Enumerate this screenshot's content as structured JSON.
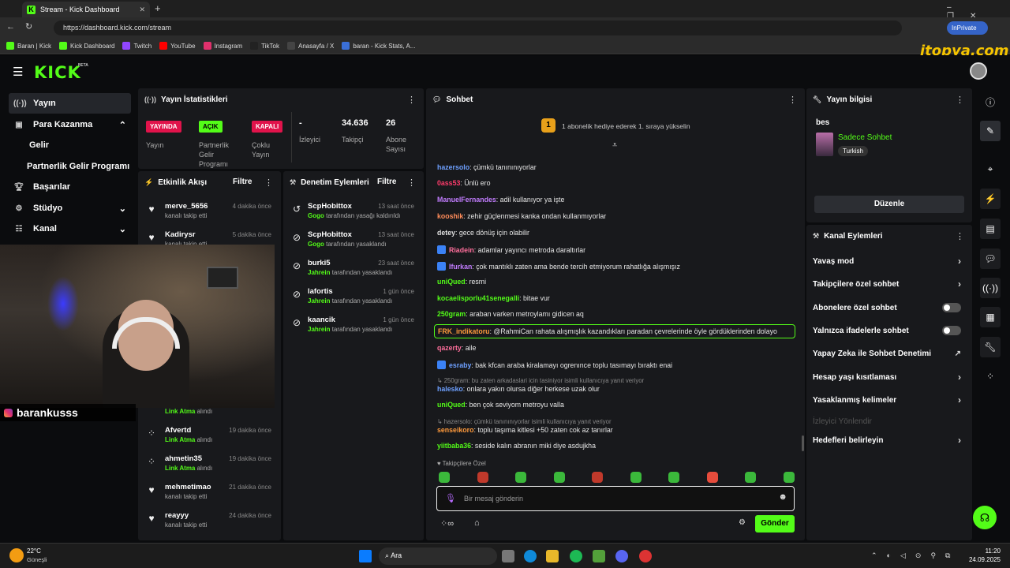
{
  "browser": {
    "tab_title": "Stream - Kick Dashboard",
    "url": "https://dashboard.kick.com/stream",
    "inprivate": "InPrivate",
    "bookmarks": [
      {
        "label": "Baran | Kick",
        "color": "#53fc18"
      },
      {
        "label": "Kick Dashboard",
        "color": "#53fc18"
      },
      {
        "label": "Twitch",
        "color": "#9146ff"
      },
      {
        "label": "YouTube",
        "color": "#ff0000"
      },
      {
        "label": "Instagram",
        "color": "#e1306c"
      },
      {
        "label": "TikTok",
        "color": "#222222"
      },
      {
        "label": "Anasayfa / X",
        "color": "#444444"
      },
      {
        "label": "baran - Kick Stats, A...",
        "color": "#3a6fd8"
      }
    ]
  },
  "watermark": "itopya.com",
  "app": {
    "logo": "KICK",
    "logo_beta": "BETA",
    "sidebar": {
      "items": [
        {
          "label": "Yayın",
          "icon": "broadcast-icon"
        },
        {
          "label": "Para Kazanma",
          "icon": "money-icon"
        },
        {
          "label": "Gelir"
        },
        {
          "label": "Partnerlik Gelir Programı"
        },
        {
          "label": "Başarılar",
          "icon": "trophy-icon"
        },
        {
          "label": "Stüdyo",
          "icon": "studio-icon"
        },
        {
          "label": "Kanal",
          "icon": "channel-icon"
        }
      ]
    },
    "stats": {
      "title": "Yayın İstatistikleri",
      "badges": [
        {
          "value": "YAYINDA",
          "label": "Yayın",
          "color": "#e1134b"
        },
        {
          "value": "AÇIK",
          "label": "Partnerlik Gelir Programı",
          "color": "#53fc18"
        },
        {
          "value": "KAPALI",
          "label": "Çoklu Yayın",
          "color": "#e1134b"
        }
      ],
      "numbers": [
        {
          "value": "-",
          "label": "İzleyici"
        },
        {
          "value": "34.636",
          "label": "Takipçi"
        },
        {
          "value": "26",
          "label": "Abone Sayısı"
        }
      ]
    },
    "activity": {
      "title": "Etkinlik Akışı",
      "filter": "Filtre",
      "items_top": [
        {
          "name": "merve_5656",
          "sub": "kanalı takip etti",
          "time": "4 dakika önce"
        },
        {
          "name": "Kadirysr",
          "sub": "kanalı takip etti",
          "time": "5 dakika önce"
        }
      ],
      "partial_sub_prefix": "Link Atma",
      "partial_sub_suffix": "alındı",
      "items_bottom": [
        {
          "name": "Afvertd",
          "sub_green": "Link Atma",
          "sub": "alındı",
          "time": "19 dakika önce",
          "icon": "gift-icon"
        },
        {
          "name": "ahmetin35",
          "sub_green": "Link Atma",
          "sub": "alındı",
          "time": "19 dakika önce",
          "icon": "gift-icon"
        },
        {
          "name": "mehmetimao",
          "sub_green": "",
          "sub": "kanalı takip etti",
          "time": "21 dakika önce",
          "icon": "heart-icon"
        },
        {
          "name": "reayyy",
          "sub_green": "",
          "sub": "kanalı takip etti",
          "time": "24 dakika önce",
          "icon": "heart-icon"
        }
      ]
    },
    "moderation": {
      "title": "Denetim Eylemleri",
      "filter": "Filtre",
      "items": [
        {
          "name": "ScpHobittox",
          "by": "Gogo",
          "action": "tarafından yasağı kaldırıldı",
          "time": "13 saat önce",
          "icon": "undo-icon"
        },
        {
          "name": "ScpHobittox",
          "by": "Gogo",
          "action": "tarafından yasaklandı",
          "time": "13 saat önce",
          "icon": "ban-icon"
        },
        {
          "name": "burki5",
          "by": "Jahrein",
          "action": "tarafından yasaklandı",
          "time": "23 saat önce",
          "icon": "ban-icon"
        },
        {
          "name": "lafortis",
          "by": "Jahrein",
          "action": "tarafından yasaklandı",
          "time": "1 gün önce",
          "icon": "ban-icon"
        },
        {
          "name": "kaancik",
          "by": "Jahrein",
          "action": "tarafından yasaklandı",
          "time": "1 gün önce",
          "icon": "ban-icon"
        }
      ]
    },
    "chat": {
      "title": "Sohbet",
      "sub_banner": "1 abonelik hediye ederek 1. sıraya yükselin",
      "sub_rank": "1",
      "messages": [
        {
          "user": "hazersolo",
          "color": "#6ea0ff",
          "text": ": çümkü tanınınıyorlar"
        },
        {
          "user": "0ass53",
          "color": "#ff3b6b",
          "text": ": Ünlü ero"
        },
        {
          "user": "ManuelFernandes",
          "color": "#c27dff",
          "text": ": adil kullanıyor ya işte"
        },
        {
          "user": "kooshik",
          "color": "#ff8c5a",
          "text": ": zehir güçlenmesi kanka ondan kullanmıyorlar"
        },
        {
          "user": "detey",
          "color": "#e0e0e0",
          "text": ": gece dönüş için olabilir"
        },
        {
          "user": "Riadein",
          "color": "#ff6f9c",
          "text": ": adamlar yayıncı metroda daraltırlar"
        },
        {
          "user": "Ifurkan",
          "color": "#c27dff",
          "text": ": çok mantıklı zaten ama bende tercih etmiyorum rahatlığa alışmışız"
        },
        {
          "user": "uniQued",
          "color": "#53fc18",
          "text": ": resmi"
        },
        {
          "user": "kocaelisporlu41senegalli",
          "color": "#53fc18",
          "text": ": bitae vur"
        },
        {
          "user": "250gram",
          "color": "#53fc18",
          "text": ": araban varken metroylamı gidicen aq"
        },
        {
          "user": "FRK_indikatoru",
          "color": "#ff9a3c",
          "text": ": @RahmiCan rahata alışmışlık kazandıkları paradan çevrelerinde öyle gördüklerinden dolayo"
        },
        {
          "user": "qazerty",
          "color": "#ff6f9c",
          "text": ": aile"
        },
        {
          "user": "esraby",
          "color": "#6ea0ff",
          "text": ": bak kfcan araba kiralamayı ogrenınce toplu tasımayı bıraktı enai"
        },
        {
          "user": "halesko",
          "color": "#6ea0ff",
          "text": ": onlara yakın olursa diğer herkese uzak olur"
        },
        {
          "user": "uniQued",
          "color": "#53fc18",
          "text": ": ben çok seviyom metroyu valla"
        },
        {
          "user": "senseikoro",
          "color": "#ff9a3c",
          "text": ": toplu taşıma kitlesi +50 zaten cok az tanırlar"
        },
        {
          "user": "yiitbaba36",
          "color": "#53fc18",
          "text": ": seside kalın abranın miki diye asdujkha"
        }
      ],
      "replies": [
        "250gram: bu zaten arkadaslari icin tasiniyor isimli kullanıcıya yanıt veriyor",
        "hazersolo: çümkü tanınınıyorlar isimli kullanıcıya yanıt veriyor"
      ],
      "followers_only": "Takipçilere Özel",
      "input_placeholder": "Bir mesaj gönderin",
      "send": "Gönder"
    },
    "stream_info": {
      "title": "Yayın bilgisi",
      "stream_title": "bes",
      "category": "Sadece Sohbet",
      "language": "Turkish",
      "edit": "Düzenle"
    },
    "channel_actions": {
      "title": "Kanal Eylemleri",
      "items": [
        {
          "label": "Yavaş mod",
          "control": "chevron"
        },
        {
          "label": "Takipçilere özel sohbet",
          "control": "chevron"
        },
        {
          "label": "Abonelere özel sohbet",
          "control": "toggle"
        },
        {
          "label": "Yalnızca ifadelerle sohbet",
          "control": "toggle"
        },
        {
          "label": "Yapay Zeka ile Sohbet Denetimi",
          "control": "external"
        },
        {
          "label": "Hesap yaşı kısıtlaması",
          "control": "chevron"
        },
        {
          "label": "Yasaklanmış kelimeler",
          "control": "chevron"
        },
        {
          "label": "İzleyici Yönlendir",
          "control": "disabled"
        },
        {
          "label": "Hedefleri belirleyin",
          "control": "chevron"
        }
      ]
    },
    "webcam_name": "barankusss"
  },
  "taskbar": {
    "weather_temp": "22°C",
    "weather_desc": "Güneşli",
    "search": "Ara",
    "time": "11:20",
    "date": "24.09.2025"
  }
}
